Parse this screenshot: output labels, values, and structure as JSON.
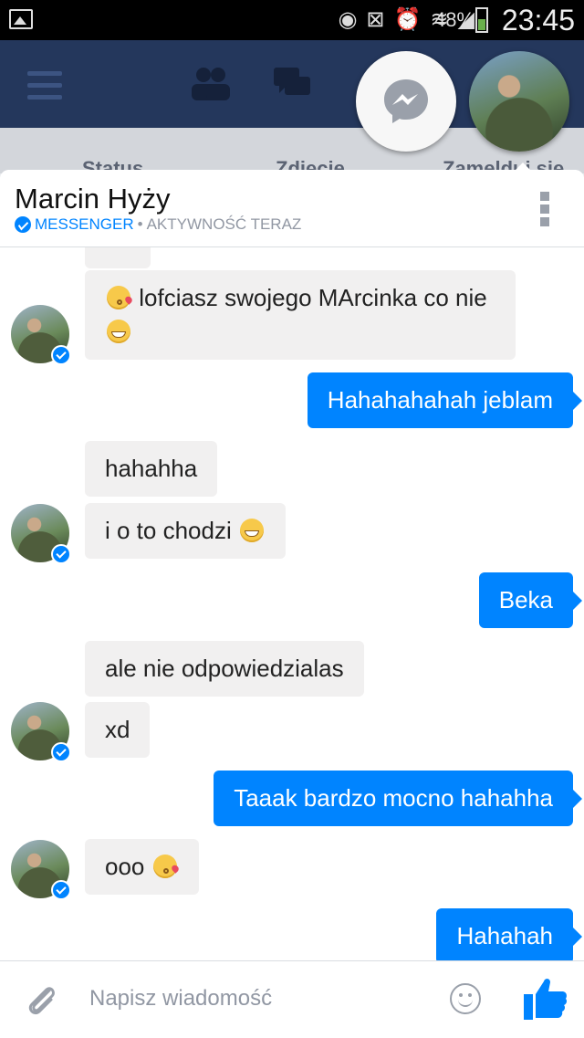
{
  "status_bar": {
    "battery": "48%",
    "time": "23:45"
  },
  "background_app": {
    "sub_items": [
      "Status",
      "Zdjęcie",
      "Zameldui się"
    ]
  },
  "conversation": {
    "contact_name": "Marcin Hyży",
    "app_label": "MESSENGER",
    "separator": "•",
    "activity": "AKTYWNOŚĆ TERAZ"
  },
  "messages": [
    {
      "from": "them",
      "text": "lofciasz swojego MArcinka co nie"
    },
    {
      "from": "me",
      "text": "Hahahahahah jeblam"
    },
    {
      "from": "them",
      "text": "hahahha"
    },
    {
      "from": "them",
      "text": "i o to chodzi"
    },
    {
      "from": "me",
      "text": "Beka"
    },
    {
      "from": "them",
      "text": "ale nie odpowiedzialas"
    },
    {
      "from": "them",
      "text": "xd"
    },
    {
      "from": "me",
      "text": "Taaak bardzo mocno hahahha"
    },
    {
      "from": "them",
      "text": "ooo"
    },
    {
      "from": "me",
      "text": "Hahahah"
    }
  ],
  "composer": {
    "placeholder": "Napisz wiadomość"
  },
  "icons": {
    "messenger": "messenger-bolt-icon",
    "attach": "paperclip-icon",
    "emoji": "smiley-icon",
    "send": "thumbs-up-icon"
  },
  "colors": {
    "accent": "#0084ff",
    "fb_bar": "#24375c",
    "incoming_bubble": "#f1f0f0"
  }
}
